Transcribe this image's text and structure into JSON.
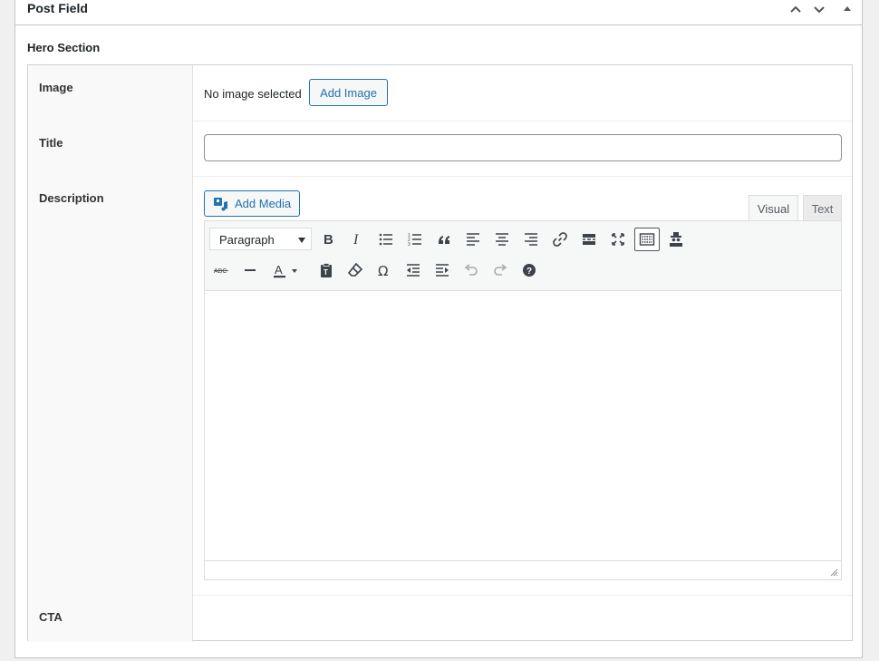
{
  "postbox": {
    "title": "Post Field",
    "controls": [
      "move-up-icon",
      "move-down-icon",
      "toggle-panel-icon"
    ]
  },
  "group": {
    "label": "Hero Section"
  },
  "fields": {
    "image": {
      "label": "Image",
      "status": "No image selected",
      "button": "Add Image"
    },
    "title": {
      "label": "Title",
      "value": ""
    },
    "description": {
      "label": "Description",
      "add_media": "Add Media",
      "tabs": {
        "visual": "Visual",
        "text": "Text",
        "active": "Visual"
      },
      "format_select": "Paragraph",
      "toolbar_row1": [
        "bold-icon",
        "italic-icon",
        "bullet-list-icon",
        "numbered-list-icon",
        "blockquote-icon",
        "align-left-icon",
        "align-center-icon",
        "align-right-icon",
        "link-icon",
        "read-more-icon",
        "fullscreen-icon",
        "toolbar-toggle-icon",
        "spy-icon"
      ],
      "toolbar_row2": [
        "strikethrough-icon",
        "horizontal-rule-icon",
        "text-color-icon",
        "paste-as-text-icon",
        "clear-formatting-icon",
        "special-character-icon",
        "outdent-icon",
        "indent-icon",
        "undo-icon",
        "redo-icon",
        "help-icon"
      ],
      "text_color_label": "A",
      "strikethrough_label": "ABC",
      "special_char": "Ω",
      "content": ""
    },
    "cta": {
      "label": "CTA"
    }
  },
  "colors": {
    "accent": "#2271b1",
    "border": "#c3c4c7",
    "background": "#f0f0f1"
  }
}
